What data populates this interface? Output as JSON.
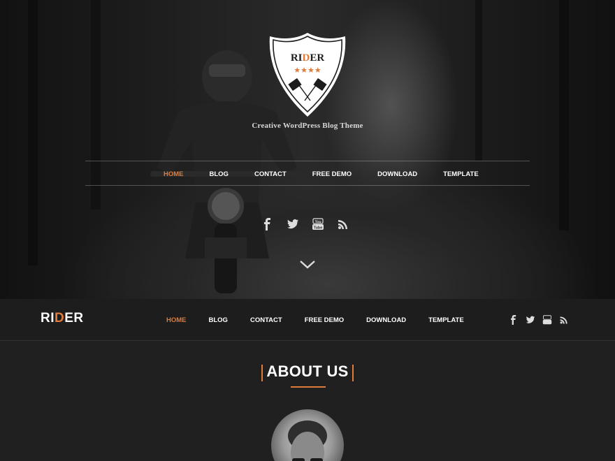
{
  "brand": {
    "prefix": "RI",
    "accent": "D",
    "suffix": "ER",
    "accent_color": "#e07b39"
  },
  "logo": {
    "title": "RIDER",
    "stars": "★★★★"
  },
  "tagline": "Creative WordPress Blog Theme",
  "nav": {
    "items": [
      {
        "label": "HOME",
        "active": true
      },
      {
        "label": "BLOG",
        "active": false
      },
      {
        "label": "CONTACT",
        "active": false
      },
      {
        "label": "FREE DEMO",
        "active": false
      },
      {
        "label": "DOWNLOAD",
        "active": false
      },
      {
        "label": "TEMPLATE",
        "active": false
      }
    ]
  },
  "social": [
    "facebook-icon",
    "twitter-icon",
    "youtube-icon",
    "rss-icon"
  ],
  "about": {
    "title": "ABOUT US"
  }
}
